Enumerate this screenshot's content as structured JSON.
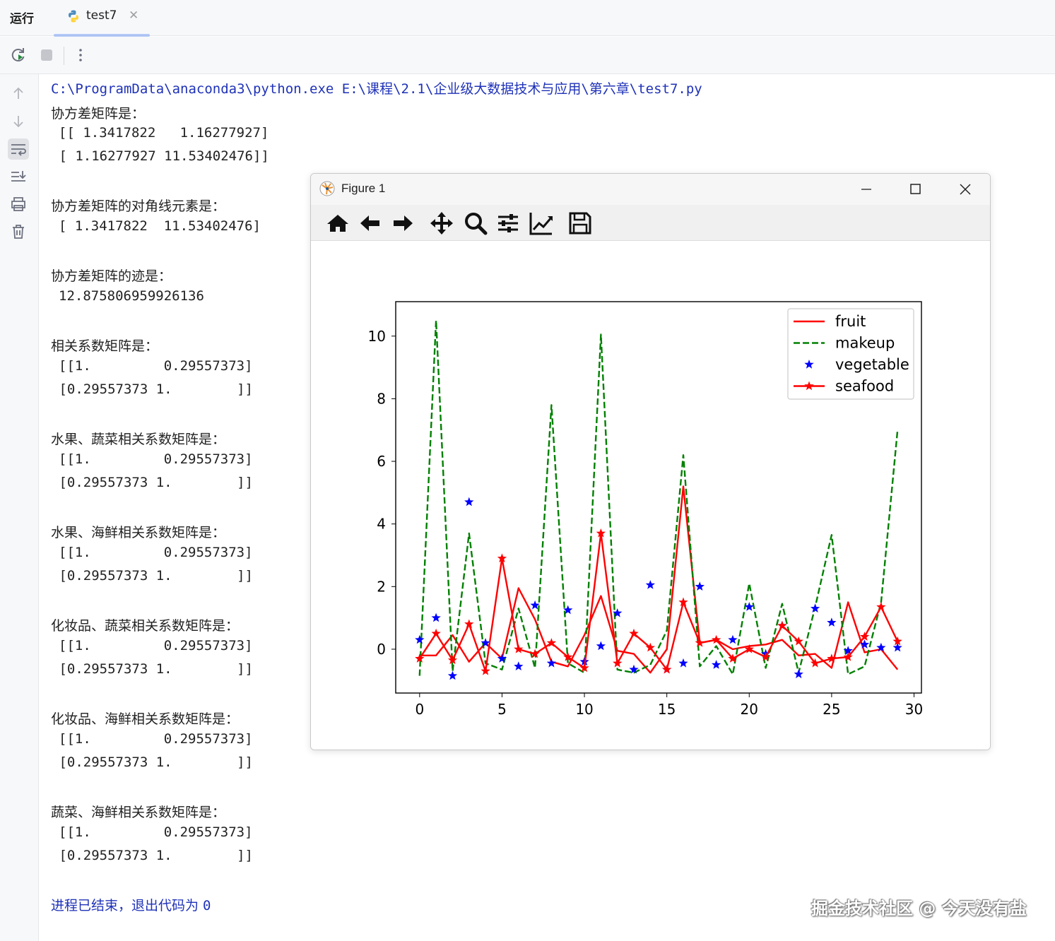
{
  "run_panel": {
    "title": "运行",
    "tab": {
      "label": "test7",
      "icon": "python-icon"
    }
  },
  "toolbar": {
    "rerun": "rerun-icon",
    "stop": "stop-icon",
    "more": "more-vertical-icon"
  },
  "gutter": [
    "arrow-up-icon",
    "arrow-down-icon",
    "soft-wrap-icon",
    "scroll-to-end-icon",
    "print-icon",
    "trash-icon"
  ],
  "console": {
    "command": "C:\\ProgramData\\anaconda3\\python.exe E:\\课程\\2.1\\企业级大数据技术与应用\\第六章\\test7.py",
    "sections": [
      {
        "heading": "协方差矩阵是：",
        "lines": [
          "[[ 1.3417822   1.16277927]",
          " [ 1.16277927 11.53402476]]"
        ]
      },
      {
        "heading": "协方差矩阵的对角线元素是：",
        "lines": [
          "[ 1.3417822  11.53402476]"
        ]
      },
      {
        "heading": "协方差矩阵的迹是：",
        "lines": [
          "12.875806959926136"
        ]
      },
      {
        "heading": "相关系数矩阵是：",
        "lines": [
          "[[1.         0.29557373]",
          " [0.29557373 1.        ]]"
        ]
      },
      {
        "heading": "水果、蔬菜相关系数矩阵是：",
        "lines": [
          "[[1.         0.29557373]",
          " [0.29557373 1.        ]]"
        ]
      },
      {
        "heading": "水果、海鲜相关系数矩阵是：",
        "lines": [
          "[[1.         0.29557373]",
          " [0.29557373 1.        ]]"
        ]
      },
      {
        "heading": "化妆品、蔬菜相关系数矩阵是：",
        "lines": [
          "[[1.         0.29557373]",
          " [0.29557373 1.        ]]"
        ]
      },
      {
        "heading": "化妆品、海鲜相关系数矩阵是：",
        "lines": [
          "[[1.         0.29557373]",
          " [0.29557373 1.        ]]"
        ]
      },
      {
        "heading": "蔬菜、海鲜相关系数矩阵是：",
        "lines": [
          "[[1.         0.29557373]",
          " [0.29557373 1.        ]]"
        ]
      }
    ],
    "exit_message": "进程已结束，退出代码为 ",
    "exit_code": "0"
  },
  "figure_window": {
    "title": "Figure 1",
    "toolbar_icons": [
      "home-icon",
      "back-icon",
      "forward-icon",
      "pan-icon",
      "zoom-icon",
      "configure-subplots-icon",
      "edit-axis-icon",
      "save-icon"
    ],
    "window_controls": [
      "minimize-icon",
      "maximize-icon",
      "close-icon"
    ]
  },
  "chart_data": {
    "type": "line",
    "x": [
      0,
      1,
      2,
      3,
      4,
      5,
      6,
      7,
      8,
      9,
      10,
      11,
      12,
      13,
      14,
      15,
      16,
      17,
      18,
      19,
      20,
      21,
      22,
      23,
      24,
      25,
      26,
      27,
      28,
      29
    ],
    "xlim": [
      -1.45,
      30.45
    ],
    "ylim": [
      -1.4,
      11.1
    ],
    "xticks": [
      0,
      5,
      10,
      15,
      20,
      25,
      30
    ],
    "yticks": [
      0,
      2,
      4,
      6,
      8,
      10
    ],
    "legend_position": "upper right",
    "series": [
      {
        "name": "fruit",
        "style": "solid",
        "marker": "none",
        "color": "#ff0000",
        "values": [
          -0.2,
          -0.2,
          0.45,
          -0.4,
          0.2,
          -0.3,
          1.95,
          0.95,
          -0.4,
          -0.55,
          0.45,
          1.7,
          -0.05,
          -0.15,
          -0.75,
          0.0,
          5.2,
          0.2,
          0.3,
          0.0,
          0.1,
          0.15,
          0.3,
          -0.2,
          -0.15,
          -0.6,
          1.5,
          -0.1,
          0.0,
          -0.65
        ]
      },
      {
        "name": "makeup",
        "style": "dashed",
        "marker": "none",
        "color": "#008000",
        "values": [
          -0.85,
          10.5,
          -0.7,
          3.7,
          -0.45,
          -0.65,
          1.3,
          -0.6,
          7.8,
          -0.45,
          -0.75,
          10.05,
          -0.65,
          -0.75,
          -0.5,
          0.6,
          6.2,
          -0.55,
          0.1,
          -0.8,
          2.1,
          -0.6,
          1.45,
          -0.75,
          1.35,
          3.65,
          -0.8,
          -0.55,
          1.5,
          7.0
        ]
      },
      {
        "name": "vegetable",
        "style": "none",
        "marker": "star",
        "color": "#0000ff",
        "values": [
          0.3,
          1.0,
          -0.85,
          4.7,
          0.2,
          -0.3,
          -0.55,
          1.4,
          -0.45,
          1.25,
          -0.4,
          0.1,
          1.15,
          -0.65,
          2.05,
          -0.65,
          -0.45,
          2.0,
          -0.5,
          0.3,
          1.35,
          -0.15,
          0.75,
          -0.8,
          1.3,
          0.85,
          -0.05,
          0.15,
          0.05,
          0.05
        ]
      },
      {
        "name": "seafood",
        "style": "solid",
        "marker": "star",
        "color": "#ff0000",
        "values": [
          -0.3,
          0.5,
          -0.35,
          0.8,
          -0.7,
          2.9,
          0.0,
          -0.15,
          0.2,
          -0.25,
          -0.6,
          3.7,
          -0.45,
          0.5,
          0.05,
          -0.65,
          1.5,
          0.2,
          0.3,
          -0.3,
          0.0,
          -0.25,
          0.75,
          0.25,
          -0.45,
          -0.3,
          -0.25,
          0.4,
          1.35,
          0.25
        ]
      }
    ]
  },
  "watermark": "掘金技术社区 @ 今天没有盐",
  "colors": {
    "accent": "#3574f0",
    "console_command": "#1f32b8",
    "fruit": "#ff0000",
    "makeup": "#008000",
    "vegetable": "#0000ff",
    "seafood": "#ff0000"
  }
}
